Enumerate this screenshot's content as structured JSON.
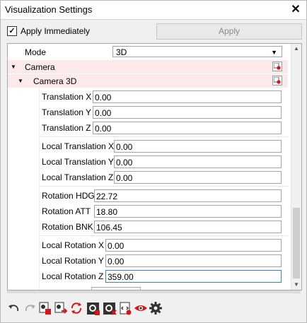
{
  "window": {
    "title": "Visualization Settings",
    "close_label": "✕"
  },
  "apply": {
    "checkbox_label": "Apply Immediately",
    "checked": true,
    "check_glyph": "✓",
    "button_label": "Apply"
  },
  "mode": {
    "label": "Mode",
    "value": "3D"
  },
  "tree": {
    "camera_label": "Camera",
    "camera3d_label": "Camera 3D"
  },
  "fields": [
    {
      "label": "Translation X",
      "value": "0.00"
    },
    {
      "label": "Translation Y",
      "value": "0.00"
    },
    {
      "label": "Translation Z",
      "value": "0.00"
    },
    {
      "label": "Local Translation X",
      "value": "0.00"
    },
    {
      "label": "Local Translation Y",
      "value": "0.00"
    },
    {
      "label": "Local Translation Z",
      "value": "0.00"
    },
    {
      "label": "Rotation HDG",
      "value": "22.72"
    },
    {
      "label": "Rotation ATT",
      "value": "18.80"
    },
    {
      "label": "Rotation BNK",
      "value": "106.45"
    },
    {
      "label": "Local Rotation X",
      "value": "0.00"
    },
    {
      "label": "Local Rotation Y",
      "value": "0.00"
    },
    {
      "label": "Local Rotation Z",
      "value": "359.00"
    }
  ],
  "toolbar": {
    "icons": [
      "undo-icon",
      "redo-icon",
      "camera-settings-icon",
      "camera-export-icon",
      "sync-icon",
      "gear-dark-icon",
      "gear-delete-icon",
      "script-icon",
      "eye-icon",
      "gear-icon"
    ]
  },
  "colors": {
    "group_bg": "#fce9e9",
    "red_accent": "#d01818",
    "focus_border": "#3c7fd1"
  }
}
